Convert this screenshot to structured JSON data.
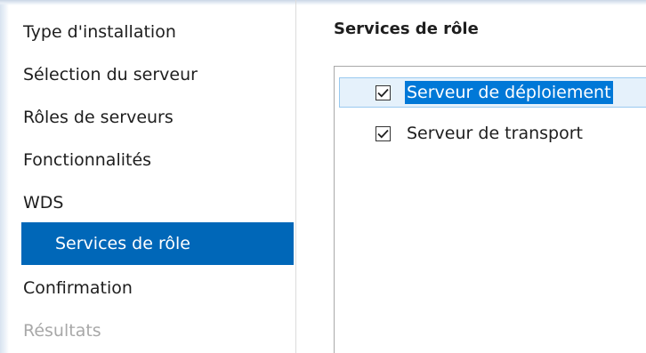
{
  "nav": {
    "items": [
      {
        "label": "Type d'installation",
        "state": "normal",
        "sub": false
      },
      {
        "label": "Sélection du serveur",
        "state": "normal",
        "sub": false
      },
      {
        "label": "Rôles de serveurs",
        "state": "normal",
        "sub": false
      },
      {
        "label": "Fonctionnalités",
        "state": "normal",
        "sub": false
      },
      {
        "label": "WDS",
        "state": "normal",
        "sub": false
      },
      {
        "label": "Services de rôle",
        "state": "selected",
        "sub": true
      },
      {
        "label": "Confirmation",
        "state": "normal",
        "sub": false
      },
      {
        "label": "Résultats",
        "state": "disabled",
        "sub": false
      }
    ]
  },
  "main": {
    "heading": "Services de rôle",
    "role_services": [
      {
        "label": "Serveur de déploiement",
        "checked": true,
        "focused": true
      },
      {
        "label": "Serveur de transport",
        "checked": true,
        "focused": false
      }
    ]
  },
  "colors": {
    "selected_bg": "#0067b8",
    "selected_text": "#ffffff",
    "text_highlight": "#0078d7",
    "focus_bg": "#e5f1fb",
    "disabled_text": "#a8a8a8"
  },
  "icons": {
    "checkbox_checked": "checkmark-icon"
  }
}
